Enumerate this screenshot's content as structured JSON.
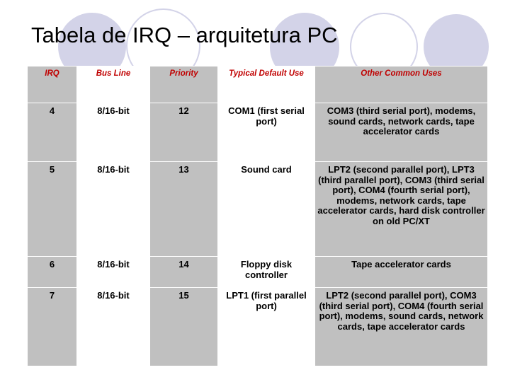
{
  "slide": {
    "title": "Tabela de IRQ – arquitetura PC",
    "accent_header_color": "#c00000",
    "cell_shade_color": "#c0c0c0",
    "decor_circle_color": "#d3d3e8",
    "background_color": "#ffffff"
  },
  "table": {
    "headers": [
      "IRQ",
      "Bus Line",
      "Priority",
      "Typical Default Use",
      "Other Common Uses"
    ],
    "rows": [
      {
        "irq": "4",
        "bus_line": "8/16-bit",
        "priority": "12",
        "typical_default_use": "COM1 (first serial port)",
        "other_common_uses": "COM3 (third serial port), modems, sound cards, network cards, tape accelerator cards"
      },
      {
        "irq": "5",
        "bus_line": "8/16-bit",
        "priority": "13",
        "typical_default_use": "Sound card",
        "other_common_uses": "LPT2 (second parallel port), LPT3 (third parallel port), COM3 (third serial port), COM4 (fourth serial port), modems, network cards, tape accelerator cards, hard disk controller on old PC/XT"
      },
      {
        "irq": "6",
        "bus_line": "8/16-bit",
        "priority": "14",
        "typical_default_use": "Floppy disk controller",
        "other_common_uses": "Tape accelerator cards"
      },
      {
        "irq": "7",
        "bus_line": "8/16-bit",
        "priority": "15",
        "typical_default_use": "LPT1 (first parallel port)",
        "other_common_uses": "LPT2 (second parallel port), COM3 (third serial port), COM4 (fourth serial port), modems, sound cards, network cards, tape accelerator cards"
      }
    ]
  }
}
